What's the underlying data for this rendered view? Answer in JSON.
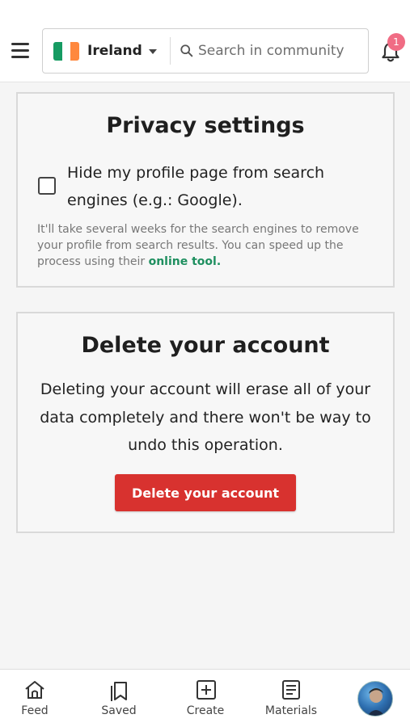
{
  "header": {
    "country": {
      "name": "Ireland",
      "flag_colors": [
        "#169b62",
        "#ffffff",
        "#ff883e"
      ]
    },
    "search": {
      "placeholder": "Search in community"
    },
    "notifications": {
      "count": "1"
    }
  },
  "privacy": {
    "title": "Privacy settings",
    "checkbox_label": "Hide my profile page from search engines (e.g.: Google).",
    "checked": false,
    "help_text": "It'll take several weeks for the search engines to remove your profile from search results. You can speed up the process using their ",
    "help_link": "online tool."
  },
  "delete_account": {
    "title": "Delete your account",
    "description": "Deleting your account will erase all of your data completely and there won't be way to undo this operation.",
    "button_label": "Delete your account",
    "button_color": "#d8322f"
  },
  "bottom_nav": {
    "items": [
      {
        "label": "Feed",
        "icon": "home-icon"
      },
      {
        "label": "Saved",
        "icon": "bookmark-icon"
      },
      {
        "label": "Create",
        "icon": "plus-square-icon"
      },
      {
        "label": "Materials",
        "icon": "document-icon"
      }
    ]
  },
  "colors": {
    "accent_link": "#1e8f5f",
    "badge": "#f06c84"
  }
}
